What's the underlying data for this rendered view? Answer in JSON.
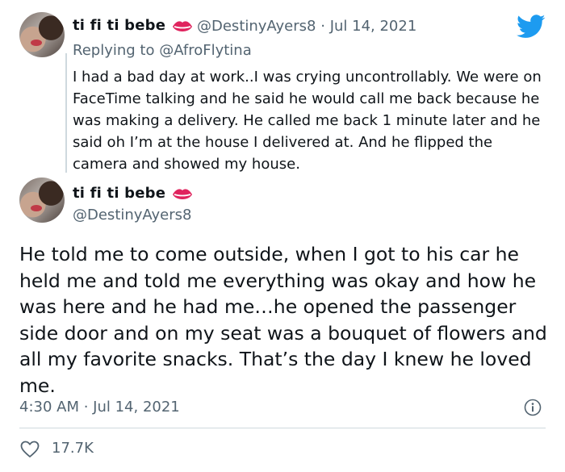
{
  "tweet1": {
    "display_name": "ti fi ti bebe",
    "handle": "@DestinyAyers8",
    "separator": "·",
    "date": "Jul 14, 2021",
    "replying_prefix": "Replying to",
    "replying_to": "@AfroFlytina",
    "text": "I had a bad day at work..I was crying uncontrollably. We were on FaceTime talking and he said he would call me back because he was making a delivery. He called me back 1 minute later and he said oh I’m at the house I delivered at. And he flipped the camera and showed my house."
  },
  "tweet2": {
    "display_name": "ti fi ti bebe",
    "handle": "@DestinyAyers8",
    "text": "He told me to come outside, when I got to his car he held me and told me everything was okay and how he was here and he had me…he opened the passenger side door and on my seat was a bouquet of flowers and all my favorite snacks. That’s the day I knew he loved me.",
    "timestamp": "4:30 AM · Jul 14, 2021",
    "likes": "17.7K"
  },
  "icons": {
    "name_emoji": "lips-icon",
    "brand": "twitter-bird-icon",
    "info": "info-icon",
    "like": "heart-icon"
  },
  "colors": {
    "brand_blue": "#1d9bf0",
    "lips_red": "#e0245e",
    "muted_text": "#536471",
    "main_text": "#0f1419"
  }
}
